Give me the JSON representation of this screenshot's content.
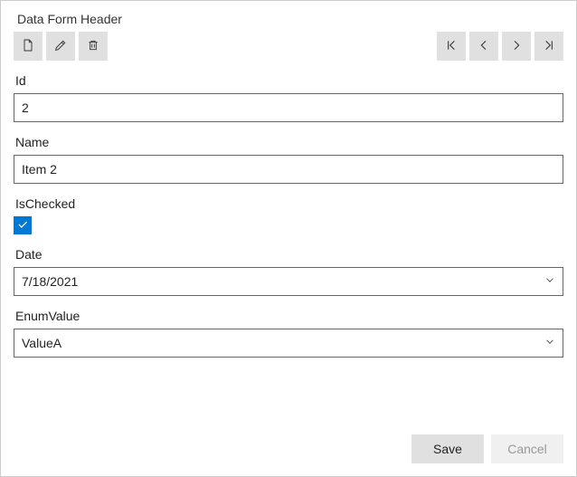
{
  "header": {
    "title": "Data Form Header"
  },
  "toolbar": {
    "left": {
      "new": "New",
      "edit": "Edit",
      "delete": "Delete"
    },
    "nav": {
      "first": "First",
      "prev": "Previous",
      "next": "Next",
      "last": "Last"
    }
  },
  "fields": {
    "id": {
      "label": "Id",
      "value": "2"
    },
    "name": {
      "label": "Name",
      "value": "Item 2"
    },
    "isChecked": {
      "label": "IsChecked",
      "checked": true
    },
    "date": {
      "label": "Date",
      "value": "7/18/2021"
    },
    "enumValue": {
      "label": "EnumValue",
      "value": "ValueA"
    }
  },
  "footer": {
    "save": "Save",
    "cancel": "Cancel"
  }
}
